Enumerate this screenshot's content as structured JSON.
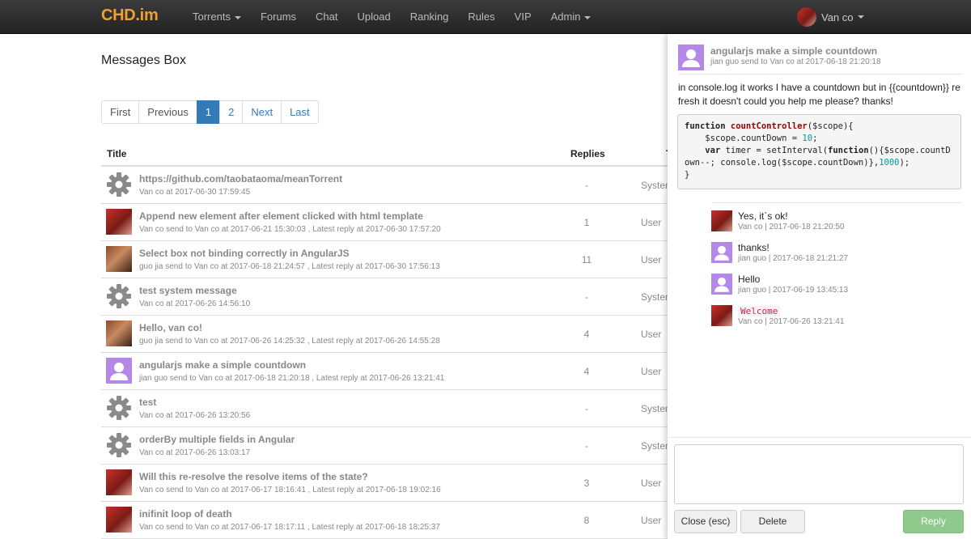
{
  "brand": "CHD.im",
  "nav": [
    {
      "label": "Torrents",
      "dropdown": true
    },
    {
      "label": "Forums",
      "dropdown": false
    },
    {
      "label": "Chat",
      "dropdown": false
    },
    {
      "label": "Upload",
      "dropdown": false
    },
    {
      "label": "Ranking",
      "dropdown": false
    },
    {
      "label": "Rules",
      "dropdown": false
    },
    {
      "label": "VIP",
      "dropdown": false
    },
    {
      "label": "Admin",
      "dropdown": true
    }
  ],
  "user": {
    "name": "Van co"
  },
  "page_title": "Messages Box",
  "pagination": {
    "first": "First",
    "previous": "Previous",
    "pages": [
      "1",
      "2"
    ],
    "active": "1",
    "next": "Next",
    "last": "Last"
  },
  "table": {
    "headers": {
      "title": "Title",
      "replies": "Replies",
      "type": "T"
    },
    "rows": [
      {
        "avatar": "gear-icon",
        "title": "https://github.com/taobataoma/meanTorrent",
        "sub": "Van co at 2017-06-30 17:59:45",
        "replies": "-",
        "type": "System"
      },
      {
        "avatar": "user-photo-avatar",
        "title": "Append new element after element clicked with html template",
        "sub": "Van co send to Van co at 2017-06-21 15:30:03 , Latest reply at 2017-06-30 17:57:20",
        "replies": "1",
        "type": "User"
      },
      {
        "avatar": "user-photo-avatar-2",
        "title": "Select box not binding correctly in AngularJS",
        "sub": "guo jia send to Van co at 2017-06-18 21:24:57 , Latest reply at 2017-06-30 17:56:13",
        "replies": "11",
        "type": "User"
      },
      {
        "avatar": "gear-icon",
        "title": "test system message",
        "sub": "Van co at 2017-06-26 14:56:10",
        "replies": "-",
        "type": "System"
      },
      {
        "avatar": "user-photo-avatar-2",
        "title": "Hello, van co!",
        "sub": "guo jia send to Van co at 2017-06-26 14:25:32 , Latest reply at 2017-06-26 14:55:28",
        "replies": "4",
        "type": "User"
      },
      {
        "avatar": "default-user-avatar",
        "title": "angularjs make a simple countdown",
        "sub": "jian guo send to Van co at 2017-06-18 21:20:18 , Latest reply at 2017-06-26 13:21:41",
        "replies": "4",
        "type": "User"
      },
      {
        "avatar": "gear-icon",
        "title": "test",
        "sub": "Van co at 2017-06-26 13:20:56",
        "replies": "-",
        "type": "System"
      },
      {
        "avatar": "gear-icon",
        "title": "orderBy multiple fields in Angular",
        "sub": "Van co at 2017-06-26 13:03:17",
        "replies": "-",
        "type": "System"
      },
      {
        "avatar": "user-photo-avatar",
        "title": "Will this re-resolve the resolve items of the state?",
        "sub": "Van co send to Van co at 2017-06-17 18:16:41 , Latest reply at 2017-06-18 19:02:16",
        "replies": "3",
        "type": "User"
      },
      {
        "avatar": "user-photo-avatar",
        "title": "inifinit loop of death",
        "sub": "Van co send to Van co at 2017-06-17 18:17:11 , Latest reply at 2017-06-18 18:25:37",
        "replies": "8",
        "type": "User"
      }
    ]
  },
  "panel": {
    "title": "angularjs make a simple countdown",
    "sub": "jian guo send to Van co at 2017-06-18 21:20:18",
    "body": "in console.log it works I have a countdown but in {{countdown}} refresh it doesn't could you help me please? thanks!",
    "code": {
      "fn_kw": "function",
      "fn_name": "countController",
      "fn_args": "($scope){",
      "line2a": "    $scope.countDown = ",
      "line2num": "10",
      "line2b": ";",
      "line3a": "    ",
      "var_kw": "var",
      "line3b": " timer = setInterval(",
      "fn_kw2": "function",
      "line3c": "(){$scope.countDown--; console.log($scope.countDown)},",
      "line3num": "1000",
      "line3d": ");",
      "line4": "}"
    },
    "replies": [
      {
        "avatar": "user-photo-avatar",
        "text": "Yes, it`s ok!",
        "meta": "Van co | 2017-06-18 21:20:50",
        "is_code": false
      },
      {
        "avatar": "default-user-avatar",
        "text": "thanks!",
        "meta": "jian guo | 2017-06-18 21:21:27",
        "is_code": false
      },
      {
        "avatar": "default-user-avatar",
        "text": "Hello",
        "meta": "jian guo | 2017-06-19 13:45:13",
        "is_code": false
      },
      {
        "avatar": "user-photo-avatar",
        "text": "Welcome",
        "meta": "Van co | 2017-06-26 13:21:41",
        "is_code": true
      }
    ],
    "textarea_value": "",
    "buttons": {
      "close": "Close (esc)",
      "delete": "Delete",
      "reply": "Reply"
    }
  }
}
